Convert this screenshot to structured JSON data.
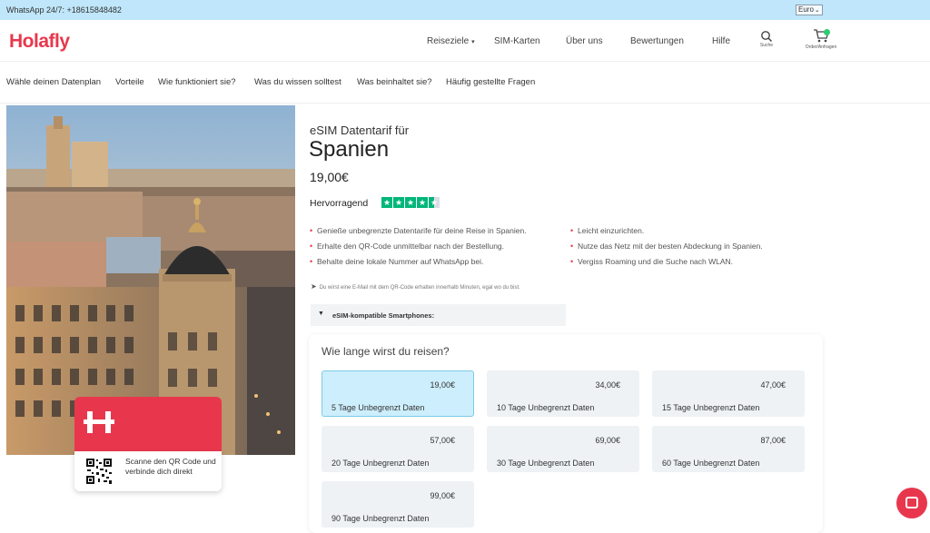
{
  "topbar": {
    "whatsapp": "WhatsApp 24/7: +18615848482",
    "currency": "Euro"
  },
  "header": {
    "logo": "Holafly",
    "nav": [
      "Reiseziele",
      "SIM-Karten",
      "Über uns",
      "Bewertungen",
      "Hilfe"
    ],
    "search_label": "Suche",
    "orders_label": "Order/Anfragen"
  },
  "subnav": [
    "Wähle deinen Datenplan",
    "Vorteile",
    "Wie funktioniert sie?",
    "Was du wissen solltest",
    "Was beinhaltet sie?",
    "Häufig gestellte Fragen"
  ],
  "card": {
    "scan_text": "Scanne den QR Code und verbinde dich direkt"
  },
  "product": {
    "pre_title": "eSIM Datentarif für",
    "title": "Spanien",
    "price": "19,00€",
    "rating_label": "Hervorragend",
    "rating_stars": 4.5,
    "features_left": [
      "Genieße unbegrenzte Datentarife für deine Reise in Spanien.",
      "Erhalte den QR-Code unmittelbar nach der Bestellung.",
      "Behalte deine lokale Nummer auf WhatsApp bei."
    ],
    "features_right": [
      "Leicht einzurichten.",
      "Nutze das Netz mit der besten Abdeckung in Spanien.",
      "Vergiss Roaming und die Suche nach WLAN."
    ],
    "email_note": "Du wirst eine E-Mail mit dem QR-Code erhalten innerhalb Minuten, egal wo du bist.",
    "compat_label": "eSIM-kompatible Smartphones:"
  },
  "plans": {
    "question": "Wie lange wirst du reisen?",
    "items": [
      {
        "price": "19,00€",
        "label": "5 Tage Unbegrenzt Daten",
        "selected": true
      },
      {
        "price": "34,00€",
        "label": "10 Tage Unbegrenzt Daten",
        "selected": false
      },
      {
        "price": "47,00€",
        "label": "15 Tage Unbegrenzt Daten",
        "selected": false
      },
      {
        "price": "57,00€",
        "label": "20 Tage Unbegrenzt Daten",
        "selected": false
      },
      {
        "price": "69,00€",
        "label": "30 Tage Unbegrenzt Daten",
        "selected": false
      },
      {
        "price": "87,00€",
        "label": "60 Tage Unbegrenzt Daten",
        "selected": false
      },
      {
        "price": "99,00€",
        "label": "90 Tage Unbegrenzt Daten",
        "selected": false
      }
    ]
  },
  "colors": {
    "brand": "#e8374d",
    "topbar": "#bfe6fa",
    "selected_plan": "#cdeefc",
    "trustpilot": "#00b67a"
  }
}
